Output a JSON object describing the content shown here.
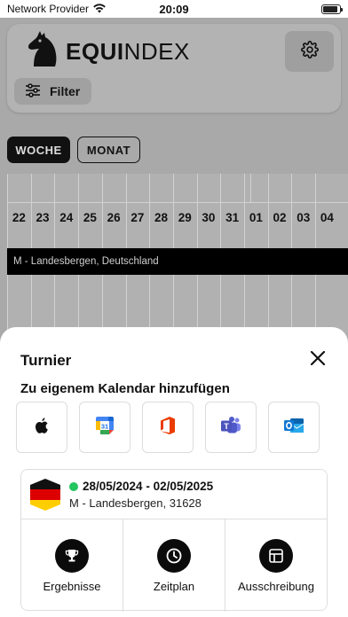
{
  "status_bar": {
    "carrier": "Network Provider",
    "time": "20:09",
    "icons": [
      "wifi-icon",
      "battery-icon"
    ]
  },
  "header": {
    "logo_bold": "EQUI",
    "logo_regular": "NDEX",
    "filter_label": "Filter",
    "icons": [
      "horse-logo-icon",
      "gear-icon",
      "sliders-icon"
    ]
  },
  "view_toggle": {
    "week_label": "WOCHE",
    "month_label": "MONAT",
    "selected": "WOCHE"
  },
  "calendar": {
    "days": [
      "22",
      "23",
      "24",
      "25",
      "26",
      "27",
      "28",
      "29",
      "30",
      "31",
      "01",
      "02",
      "03",
      "04"
    ],
    "event_label": "M - Landesbergen, Deutschland"
  },
  "sheet": {
    "title": "Turnier",
    "calendar_title": "Zu eigenem Kalendar hinzufügen",
    "calendar_options": [
      "apple-icon",
      "google-calendar-icon",
      "office-icon",
      "teams-icon",
      "outlook-icon"
    ],
    "event": {
      "date_range": "28/05/2024 - 02/05/2025",
      "location": "M - Landesbergen, 31628",
      "status_color": "#22c55e",
      "flag": "germany-flag-icon"
    },
    "actions": [
      {
        "label": "Ergebnisse",
        "icon": "trophy-icon"
      },
      {
        "label": "Zeitplan",
        "icon": "clock-icon"
      },
      {
        "label": "Ausschreibung",
        "icon": "table-icon"
      }
    ]
  },
  "colors": {
    "overlay_bg": "#a9a9a9",
    "event_bar": "#000000",
    "accent_dark": "#111111",
    "status_green": "#22c55e"
  }
}
